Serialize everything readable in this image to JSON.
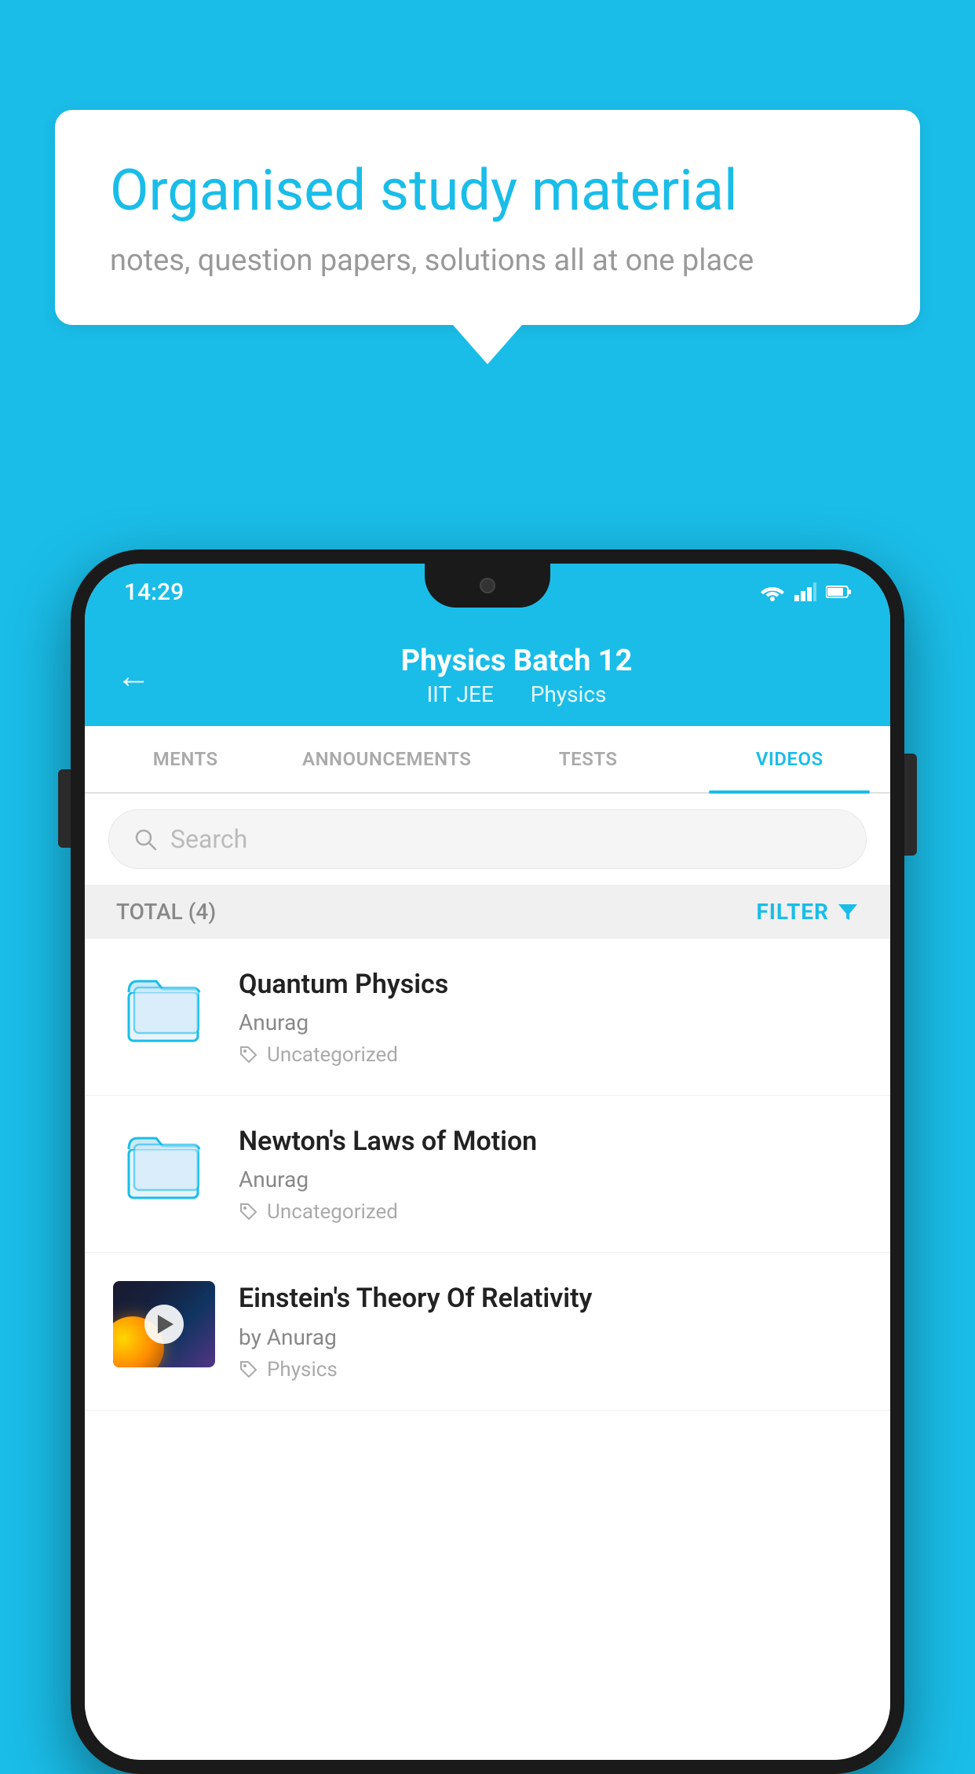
{
  "background_color": "#1abde8",
  "speech_bubble": {
    "title": "Organised study material",
    "subtitle": "notes, question papers, solutions all at one place"
  },
  "phone": {
    "status_bar": {
      "time": "14:29",
      "icons": [
        "wifi",
        "signal",
        "battery"
      ]
    },
    "header": {
      "back_label": "←",
      "title": "Physics Batch 12",
      "subtitle_part1": "IIT JEE",
      "subtitle_part2": "Physics"
    },
    "tabs": [
      {
        "label": "MENTS",
        "active": false
      },
      {
        "label": "ANNOUNCEMENTS",
        "active": false
      },
      {
        "label": "TESTS",
        "active": false
      },
      {
        "label": "VIDEOS",
        "active": true
      }
    ],
    "search": {
      "placeholder": "Search"
    },
    "filter_bar": {
      "total_label": "TOTAL (4)",
      "filter_label": "FILTER"
    },
    "videos": [
      {
        "title": "Quantum Physics",
        "author": "Anurag",
        "tag": "Uncategorized",
        "type": "folder"
      },
      {
        "title": "Newton's Laws of Motion",
        "author": "Anurag",
        "tag": "Uncategorized",
        "type": "folder"
      },
      {
        "title": "Einstein's Theory Of Relativity",
        "author": "by Anurag",
        "tag": "Physics",
        "type": "video"
      }
    ]
  }
}
